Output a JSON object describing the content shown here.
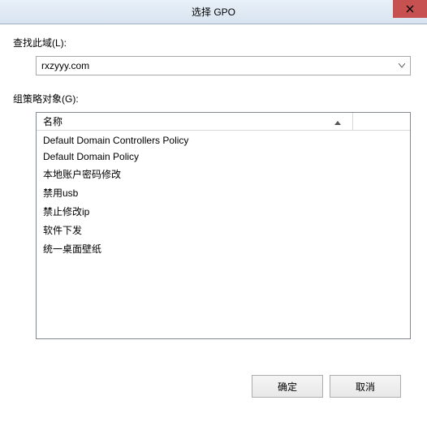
{
  "titlebar": {
    "title": "选择 GPO"
  },
  "domain": {
    "label": "查找此域(L):",
    "value": "rxzyyy.com"
  },
  "gpo": {
    "label": "组策略对象(G):",
    "header_name": "名称",
    "items": [
      "Default Domain Controllers Policy",
      "Default Domain Policy",
      "本地账户密码修改",
      "禁用usb",
      "禁止修改ip",
      "软件下发",
      "统一桌面壁纸"
    ]
  },
  "buttons": {
    "ok": "确定",
    "cancel": "取消"
  }
}
